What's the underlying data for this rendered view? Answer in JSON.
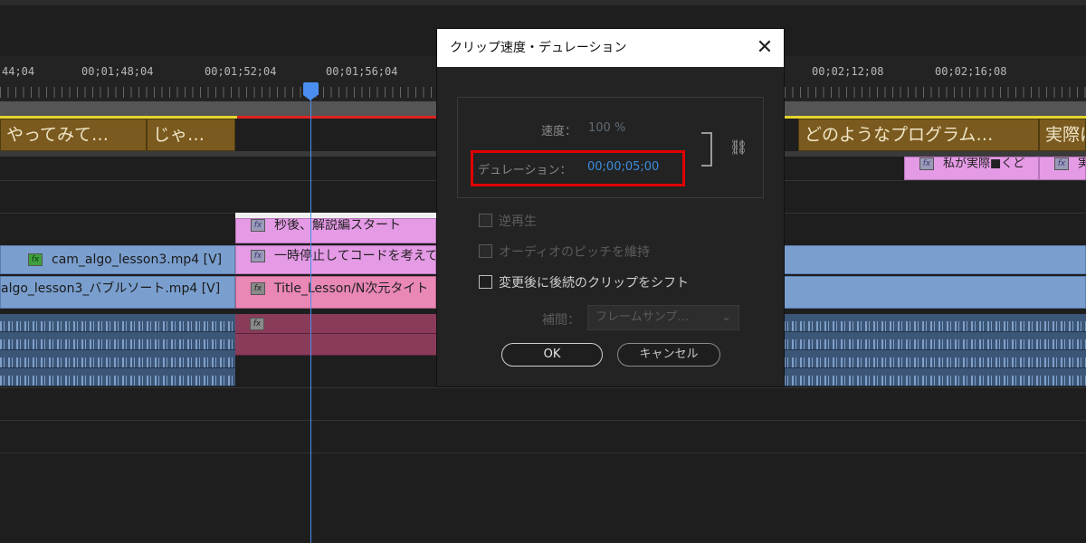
{
  "timeline": {
    "timecodes": [
      "44;04",
      "00;01;48;04",
      "00;01;52;04",
      "00;01;56;04",
      "00;02;12;08",
      "00;02;16;08"
    ],
    "captions": [
      "やってみて…",
      "じゃ…",
      "どのようなプログラム…",
      "実際に"
    ],
    "subtitle_clips": [
      "私が実際■くど",
      "実"
    ],
    "pink_clips": [
      "秒後、解説編スタート",
      "一時停止してコードを考えて"
    ],
    "video_clips": [
      "cam_algo_lesson3.mp4 [V]",
      "algo_lesson3_バブルソート.mp4 [V]"
    ],
    "title_clip": "Title_Lesson/N次元タイト",
    "fx_label": "fx"
  },
  "dialog": {
    "title": "クリップ速度・デュレーション",
    "close_glyph": "✕",
    "speed_label": "速度：",
    "speed_value": "100 %",
    "duration_label": "デュレーション：",
    "duration_value": "00;00;05;00",
    "chain_glyph": "⛓",
    "options": [
      {
        "label": "逆再生",
        "enabled": false
      },
      {
        "label": "オーディオのピッチを維持",
        "enabled": false
      },
      {
        "label": "変更後に後続のクリップをシフト",
        "enabled": true
      }
    ],
    "interp_label": "補間：",
    "interp_value": "フレームサンプ…",
    "chevron_glyph": "⌄",
    "ok_label": "OK",
    "cancel_label": "キャンセル"
  },
  "colors": {
    "accent_blue": "#3a8de0",
    "highlight_red": "#e00000",
    "caption_brown": "#7a5a1e",
    "video_blue": "#7a9fcf",
    "pink": "#e59ae6"
  }
}
